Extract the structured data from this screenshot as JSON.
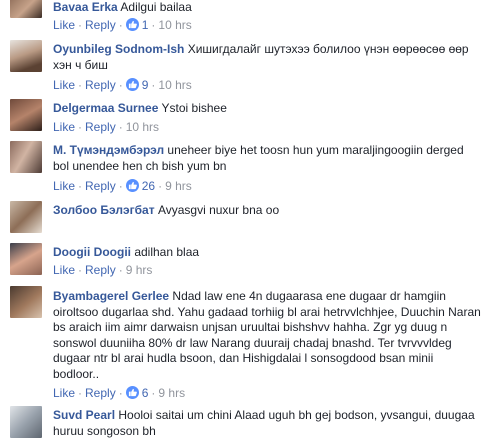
{
  "ui": {
    "like_label": "Like",
    "reply_label": "Reply",
    "separator": "·"
  },
  "comments": [
    {
      "author": "Bavaa Erka",
      "text": "Adilgui bailaa",
      "reactions": "1",
      "time": "10 hrs"
    },
    {
      "author": "Oyunbileg Sodnom-Ish",
      "text": "Хишигдалайг шутэхээ болилоо үнэн өөрөөсөө өөр хэн ч биш",
      "reactions": "9",
      "time": "10 hrs"
    },
    {
      "author": "Delgermaa Surnee",
      "text": "Ystoi bishee",
      "reactions": null,
      "time": "10 hrs"
    },
    {
      "author": "М. Түмэндэмбэрэл",
      "text": "uneheer biye het toosn hun yum maraljingoogiin derged bol unendee hen ch bish yum bn",
      "reactions": "26",
      "time": "9 hrs"
    },
    {
      "author": "Золбоо Бэлэгбат",
      "text": "Avyasgvi nuxur bna oo",
      "reactions": null,
      "time": null
    },
    {
      "author": "Doogii Doogii",
      "text": "adilhan blaa",
      "reactions": null,
      "time": "9 hrs"
    },
    {
      "author": "Byambagerel Gerlee",
      "text": "Ndad law ene 4n dugaarasa ene dugaar dr hamgiin oiroltsoo dugarlaa shd. Yahu gadaad torhiig bl arai hetrvvlchhjee, Duuchin Naran bs araich iim aimr darwaisn unjsan uruultai bishshvv hahha. Zgr yg duug n sonswol duuniiha 80% dr law Narang duuraij chadaj bnashd. Ter tvrvvvldeg dugaar ntr bl arai hudla bsoon, dan Hishigdalai l sonsogdood bsan minii bodloor..",
      "reactions": "6",
      "time": "9 hrs"
    },
    {
      "author": "Suvd Pearl",
      "text": "Hooloi saitai um chini Alaad uguh bh gej bodson, yvsangui, duugaa huruu songoson bh",
      "reactions": null,
      "time": null
    }
  ],
  "colors": {
    "author": "#365899",
    "action_link": "#4267b2",
    "meta": "#90949c",
    "like_badge": "#5890ff"
  },
  "icons": [
    "like-thumb-icon"
  ]
}
